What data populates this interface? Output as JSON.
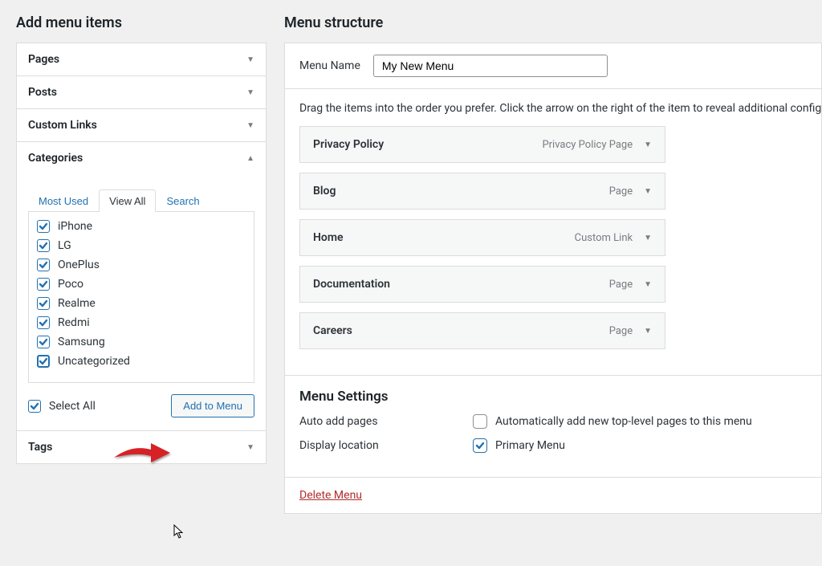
{
  "left": {
    "heading": "Add menu items",
    "accordions": [
      {
        "title": "Pages",
        "open": false
      },
      {
        "title": "Posts",
        "open": false
      },
      {
        "title": "Custom Links",
        "open": false
      },
      {
        "title": "Categories",
        "open": true
      },
      {
        "title": "Tags",
        "open": false
      }
    ],
    "category_tabs": [
      "Most Used",
      "View All",
      "Search"
    ],
    "category_active_tab": "View All",
    "categories": [
      {
        "name": "iPhone",
        "checked": true
      },
      {
        "name": "LG",
        "checked": true
      },
      {
        "name": "OnePlus",
        "checked": true
      },
      {
        "name": "Poco",
        "checked": true
      },
      {
        "name": "Realme",
        "checked": true
      },
      {
        "name": "Redmi",
        "checked": true
      },
      {
        "name": "Samsung",
        "checked": true
      },
      {
        "name": "Uncategorized",
        "checked": true
      }
    ],
    "select_all_label": "Select All",
    "select_all_checked": true,
    "add_to_menu_label": "Add to Menu"
  },
  "right": {
    "heading": "Menu structure",
    "menu_name_label": "Menu Name",
    "menu_name_value": "My New Menu",
    "instructions": "Drag the items into the order you prefer. Click the arrow on the right of the item to reveal additional configuration options.",
    "items": [
      {
        "title": "Privacy Policy",
        "type": "Privacy Policy Page"
      },
      {
        "title": "Blog",
        "type": "Page"
      },
      {
        "title": "Home",
        "type": "Custom Link"
      },
      {
        "title": "Documentation",
        "type": "Page"
      },
      {
        "title": "Careers",
        "type": "Page"
      }
    ],
    "settings": {
      "heading": "Menu Settings",
      "auto_add_label": "Auto add pages",
      "auto_add_checkbox_label": "Automatically add new top-level pages to this menu",
      "auto_add_checked": false,
      "display_location_label": "Display location",
      "display_location_option": "Primary Menu",
      "display_location_checked": true
    },
    "delete_label": "Delete Menu"
  }
}
